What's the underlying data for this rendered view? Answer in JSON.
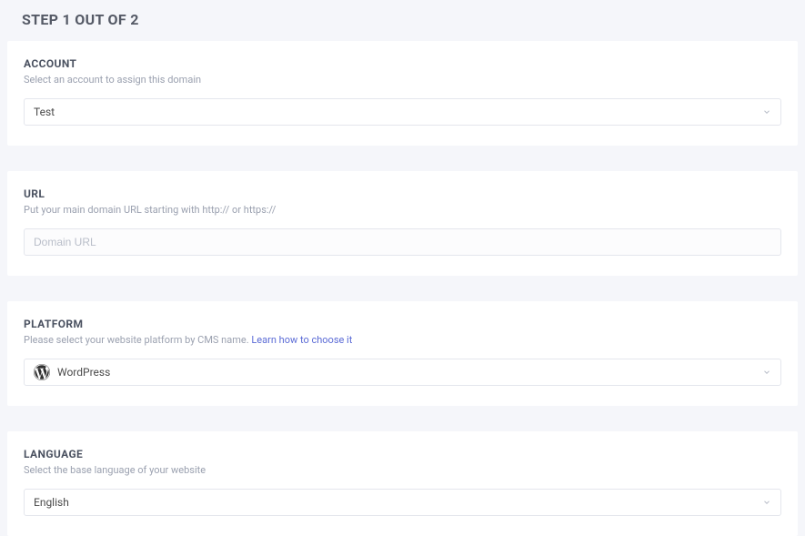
{
  "page": {
    "step_title": "STEP 1 OUT OF 2"
  },
  "account": {
    "label": "ACCOUNT",
    "hint": "Select an account to assign this domain",
    "selected": "Test"
  },
  "url": {
    "label": "URL",
    "hint": "Put your main domain URL starting with http:// or https://",
    "placeholder": "Domain URL",
    "value": ""
  },
  "platform": {
    "label": "PLATFORM",
    "hint_prefix": "Please select your website platform by CMS name. ",
    "hint_link": "Learn how to choose it",
    "selected": "WordPress",
    "icon": "wordpress-icon"
  },
  "language": {
    "label": "LANGUAGE",
    "hint": "Select the base language of your website",
    "selected": "English"
  }
}
